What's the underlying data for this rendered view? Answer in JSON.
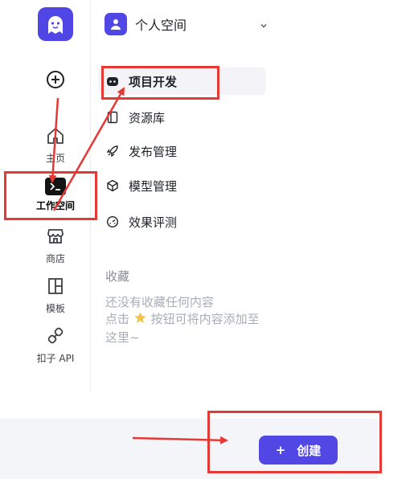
{
  "rail": {
    "logo_icon": "ghost-logo-icon",
    "add_icon": "plus-circle-icon",
    "items": [
      {
        "label": "主页",
        "icon": "home-icon"
      },
      {
        "label": "工作空间",
        "icon": "terminal-icon"
      },
      {
        "label": "商店",
        "icon": "store-icon"
      },
      {
        "label": "模板",
        "icon": "layout-icon"
      },
      {
        "label": "扣子 API",
        "icon": "plug-icon"
      }
    ]
  },
  "space": {
    "name": "个人空间",
    "icon": "user-icon"
  },
  "menu": [
    {
      "label": "项目开发",
      "icon": "robot-icon"
    },
    {
      "label": "资源库",
      "icon": "library-icon"
    },
    {
      "label": "发布管理",
      "icon": "rocket-icon"
    },
    {
      "label": "模型管理",
      "icon": "cube-icon"
    },
    {
      "label": "效果评测",
      "icon": "gauge-icon"
    }
  ],
  "favorites": {
    "title": "收藏",
    "empty_line1": "还没有收藏任何内容",
    "empty_line2_prefix": "点击",
    "empty_line2_suffix": "按钮可将内容添加至",
    "empty_line3": "这里~"
  },
  "create_button": {
    "plus": "+",
    "label": "创建"
  },
  "colors": {
    "brand": "#5147e5",
    "annotation": "#e53935"
  }
}
